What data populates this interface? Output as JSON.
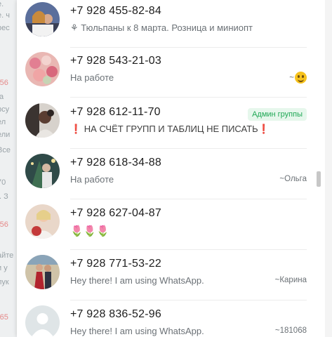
{
  "contacts": [
    {
      "phone": "+7 928 455-82-84",
      "status": "⚘ Тюльпаны к 8 марта. Розница и миниопт",
      "note": "",
      "badge": ""
    },
    {
      "phone": "+7 928 543-21-03",
      "status": "На работе",
      "note": "~",
      "badge": ""
    },
    {
      "phone": "+7 928 612-11-70",
      "status": "❗ НА СЧЁТ ГРУПП И ТАБЛИЦ НЕ ПИСАТЬ❗",
      "note": "",
      "badge": "Админ группы"
    },
    {
      "phone": "+7 928 618-34-88",
      "status": "На работе",
      "note": "~Ольга",
      "badge": ""
    },
    {
      "phone": "+7 928 627-04-87",
      "status": "🌷🌷🌷",
      "note": "",
      "badge": ""
    },
    {
      "phone": "+7 928 771-53-22",
      "status": "Hey there! I am using WhatsApp.",
      "note": "~Карина",
      "badge": ""
    },
    {
      "phone": "+7 928 836-52-96",
      "status": "Hey there! I am using WhatsApp.",
      "note": "~181068",
      "badge": ""
    }
  ],
  "icons": {
    "smile": "smiling-face-emoji",
    "default_avatar": "default-user-avatar-icon"
  },
  "colors": {
    "admin_badge_text": "#1fa855",
    "admin_badge_bg": "#e6f7ec"
  }
}
